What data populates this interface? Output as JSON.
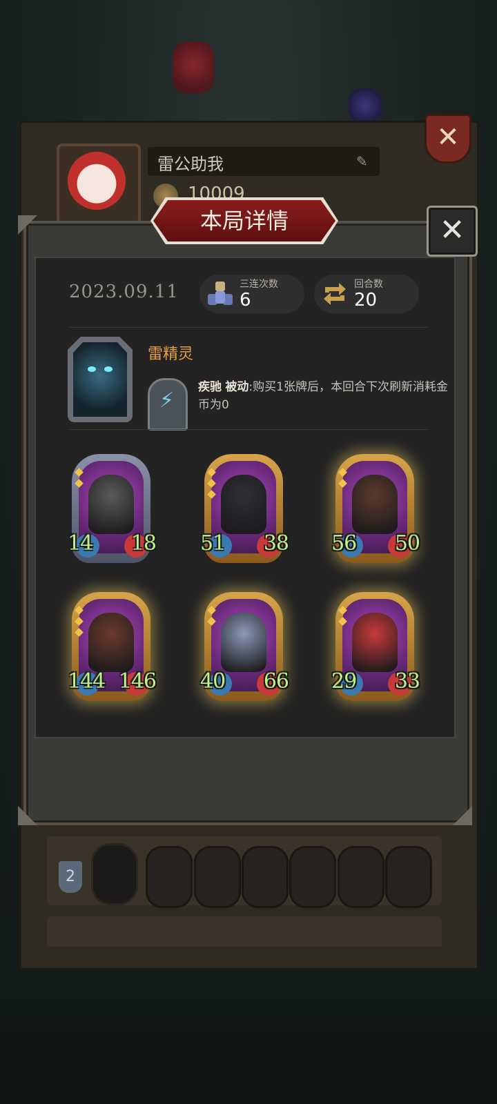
{
  "background": {
    "profile": {
      "player_name": "雷公助我",
      "coins": "10009"
    },
    "list_rows": [
      {
        "rank": "2"
      },
      {
        "rank": ""
      }
    ]
  },
  "modal": {
    "title": "本局详情",
    "date": "2023.09.11",
    "stats": [
      {
        "label": "三连次数",
        "value": "6",
        "icon": "triple-icon"
      },
      {
        "label": "回合数",
        "value": "20",
        "icon": "rounds-icon"
      }
    ],
    "hero": {
      "name": "雷精灵",
      "skill_name": "疾驰",
      "skill_type": "被动",
      "skill_desc": ":购买1张牌后，本回合下次刷新消耗金币为0"
    },
    "cards": [
      {
        "attack": "14",
        "health": "18",
        "stars": 2,
        "frame": "silver"
      },
      {
        "attack": "51",
        "health": "38",
        "stars": 3,
        "frame": "gold"
      },
      {
        "attack": "56",
        "health": "50",
        "stars": 2,
        "frame": "gold"
      },
      {
        "attack": "144",
        "health": "146",
        "stars": 3,
        "frame": "gold"
      },
      {
        "attack": "40",
        "health": "66",
        "stars": 2,
        "frame": "gold"
      },
      {
        "attack": "29",
        "health": "33",
        "stars": 2,
        "frame": "gold"
      }
    ]
  },
  "colors": {
    "hero_name": "#e8a040",
    "stat_number": "#bff08a",
    "title_ribbon": "#8a1c1c"
  }
}
